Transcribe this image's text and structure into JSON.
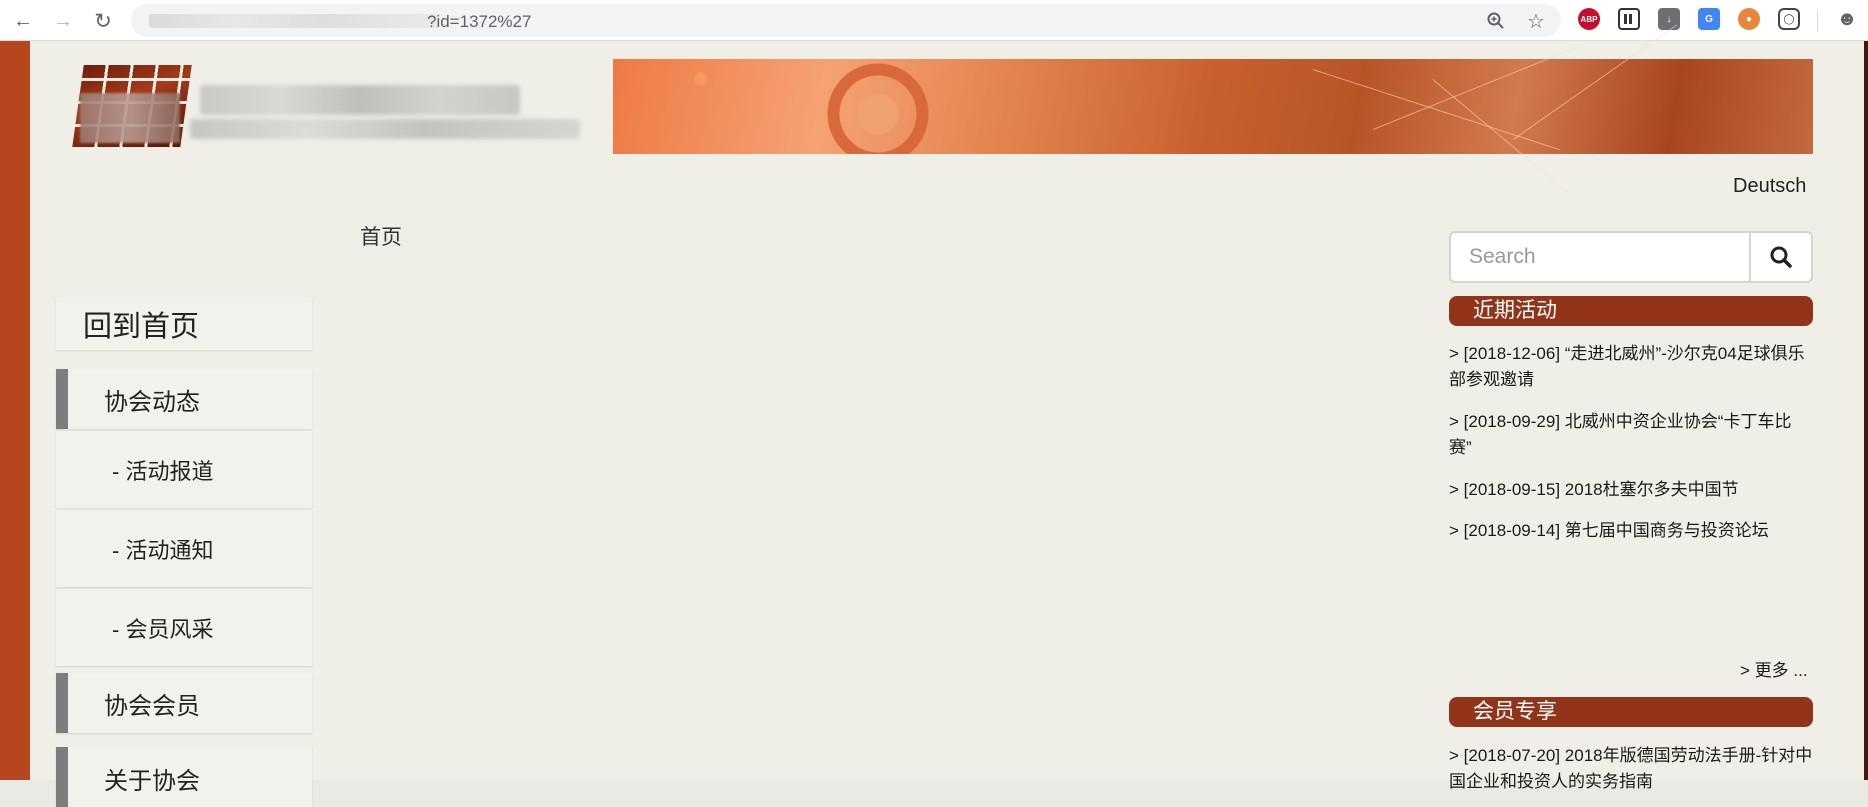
{
  "browser": {
    "url_suffix": "?id=1372%27",
    "icons": {
      "back": "arrow-left-icon",
      "forward": "arrow-right-icon",
      "reload": "reload-icon",
      "zoom": "zoom-icon",
      "bookmark": "star-icon"
    },
    "extensions": {
      "abp_label": "ABP"
    }
  },
  "header": {
    "language_link": "Deutsch"
  },
  "breadcrumb": {
    "home": "首页"
  },
  "search": {
    "placeholder": "Search"
  },
  "menu": {
    "home": "回到首页",
    "category_news": "协会动态",
    "sub_items": [
      "- 活动报道",
      "- 活动通知",
      "- 会员风采"
    ],
    "category_members": "协会会员",
    "category_about": "关于协会"
  },
  "recent_events": {
    "title": "近期活动",
    "items": [
      "> [2018-12-06] “走进北威州”-沙尔克04足球俱乐部参观邀请",
      "> [2018-09-29] 北威州中资企业协会“卡丁车比赛”",
      "> [2018-09-15] 2018杜塞尔多夫中国节",
      "> [2018-09-14] 第七届中国商务与投资论坛"
    ],
    "more": "> 更多 ..."
  },
  "members_only": {
    "title": "会员专享",
    "items": [
      "> [2018-07-20] 2018年版德国劳动法手册-针对中国企业和投资人的实务指南"
    ]
  },
  "colors": {
    "brand": "#91341a",
    "edge": "#b5461d",
    "page_bg": "#efefe8",
    "menu_accent": "#7d7d7d"
  }
}
